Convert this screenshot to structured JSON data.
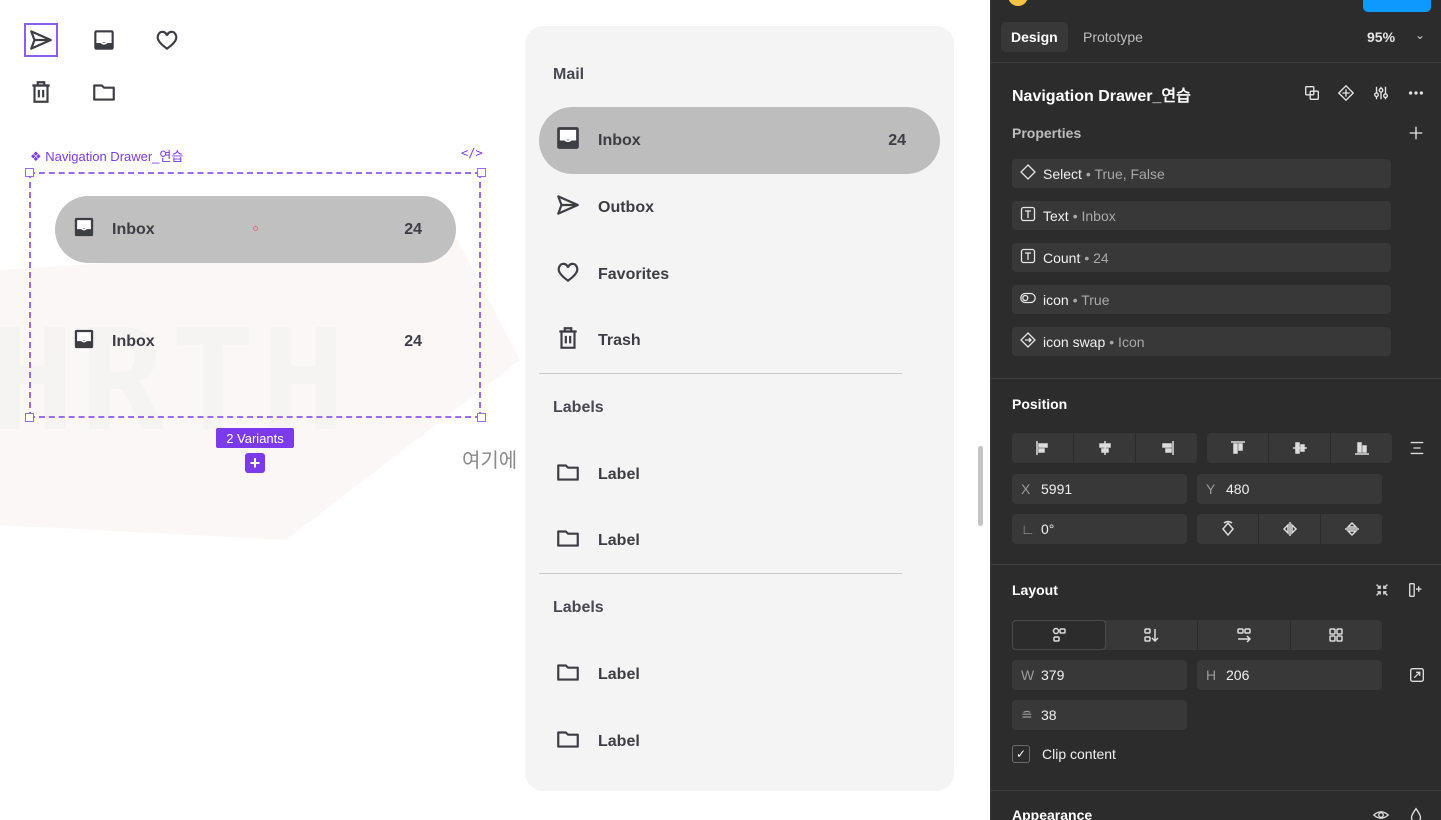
{
  "canvas": {
    "component_label": "❖ Navigation Drawer_연습",
    "code_icon": "</>",
    "variants": [
      {
        "label": "Inbox",
        "count": "24",
        "selected": true
      },
      {
        "label": "Inbox",
        "count": "24",
        "selected": false
      }
    ],
    "variants_badge": "2 Variants",
    "variants_add": "+",
    "side_text": "여기에",
    "top_icons": [
      "send-icon",
      "inbox-icon",
      "heart-icon",
      "trash-icon",
      "folder-icon"
    ]
  },
  "drawer": {
    "heading_mail": "Mail",
    "items": [
      {
        "label": "Inbox",
        "count": "24",
        "icon": "inbox-icon",
        "active": true
      },
      {
        "label": "Outbox",
        "count": "",
        "icon": "send-icon"
      },
      {
        "label": "Favorites",
        "count": "",
        "icon": "heart-icon"
      },
      {
        "label": "Trash",
        "count": "",
        "icon": "trash-icon"
      }
    ],
    "labels_1": {
      "heading": "Labels",
      "items": [
        "Label",
        "Label"
      ]
    },
    "labels_2": {
      "heading": "Labels",
      "items": [
        "Label",
        "Label"
      ]
    }
  },
  "panel": {
    "tabs": [
      "Design",
      "Prototype"
    ],
    "zoom": "95%",
    "component_name": "Navigation Drawer_연습",
    "properties_title": "Properties",
    "properties": [
      {
        "name": "Select",
        "value": "• True, False",
        "icon": "variant-diamond-icon"
      },
      {
        "name": "Text",
        "value": "• Inbox",
        "icon": "text-property-icon"
      },
      {
        "name": "Count",
        "value": "• 24",
        "icon": "text-property-icon"
      },
      {
        "name": "icon",
        "value": "• True",
        "icon": "boolean-toggle-icon"
      },
      {
        "name": "icon swap",
        "value": "• Icon",
        "icon": "instance-swap-icon"
      }
    ],
    "position": {
      "title": "Position",
      "x_label": "X",
      "x": "5991",
      "y_label": "Y",
      "y": "480",
      "rotation": "0°"
    },
    "layout": {
      "title": "Layout",
      "w_label": "W",
      "w": "379",
      "h_label": "H",
      "h": "206",
      "gap": "38",
      "clip_content": "Clip content"
    },
    "appearance_title": "Appearance",
    "accent": "#0d99ff"
  }
}
